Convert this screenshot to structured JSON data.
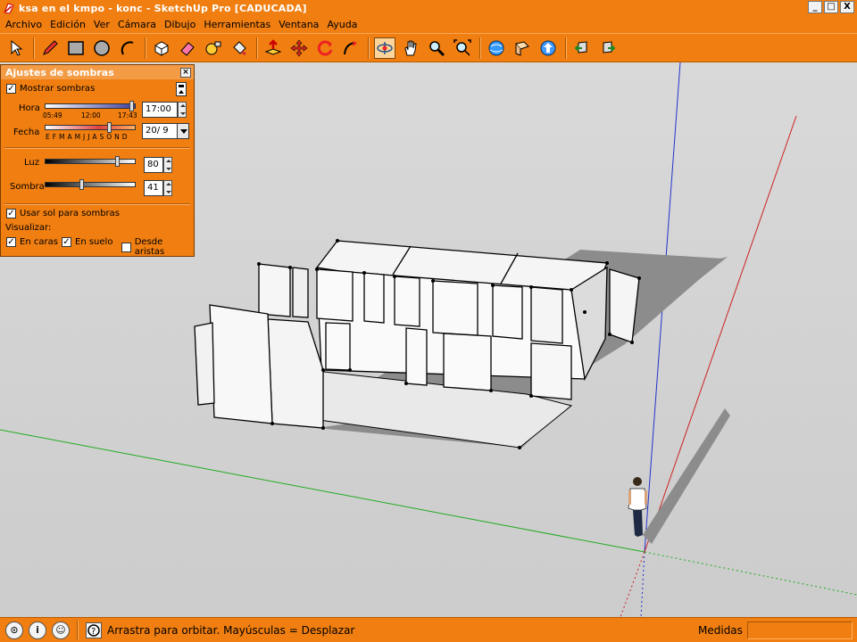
{
  "window": {
    "title": "ksa en el kmpo - konc - SketchUp Pro [CADUCADA]",
    "controls": [
      "_",
      "□",
      "X"
    ]
  },
  "menubar": {
    "items": [
      "Archivo",
      "Edición",
      "Ver",
      "Cámara",
      "Dibujo",
      "Herramientas",
      "Ventana",
      "Ayuda"
    ]
  },
  "toolbar": {
    "tools": [
      "select-arrow",
      "pencil",
      "rectangle",
      "circle",
      "arc",
      "make-component",
      "eraser",
      "tape-measure",
      "paint-bucket",
      "push-pull",
      "move",
      "rotate",
      "follow-me",
      "orbit",
      "pan",
      "zoom",
      "zoom-extents",
      "get-models",
      "share-model",
      "share-component",
      "previous-view",
      "next-view"
    ],
    "active_tool": "orbit"
  },
  "shadow_panel": {
    "title": "Ajustes de sombras",
    "show_shadows_label": "Mostrar sombras",
    "show_shadows_checked": true,
    "time_label": "Hora",
    "time_value": "17:00",
    "time_ticks": [
      "05:49",
      "12:00",
      "17:43"
    ],
    "time_fraction": 0.96,
    "date_label": "Fecha",
    "date_value": "20/ 9",
    "date_months": "E F M A M J J A S O N D",
    "date_fraction": 0.72,
    "light_label": "Luz",
    "light_value": "80",
    "light_fraction": 0.8,
    "dark_label": "Sombra",
    "dark_value": "41",
    "dark_fraction": 0.41,
    "use_sun_label": "Usar sol para sombras",
    "use_sun_checked": true,
    "display_label": "Visualizar:",
    "on_faces_label": "En caras",
    "on_faces_checked": true,
    "on_ground_label": "En suelo",
    "on_ground_checked": true,
    "from_edges_label": "Desde aristas",
    "from_edges_checked": false
  },
  "statusbar": {
    "hint": "Arrastra para orbitar. Mayúsculas = Desplazar",
    "measures_label": "Medidas",
    "measures_value": ""
  },
  "colors": {
    "chrome": "#f07e10",
    "viewport": "#cfcfcf",
    "axis_red": "#cc2222",
    "axis_green": "#22aa22",
    "axis_blue": "#2233cc"
  }
}
